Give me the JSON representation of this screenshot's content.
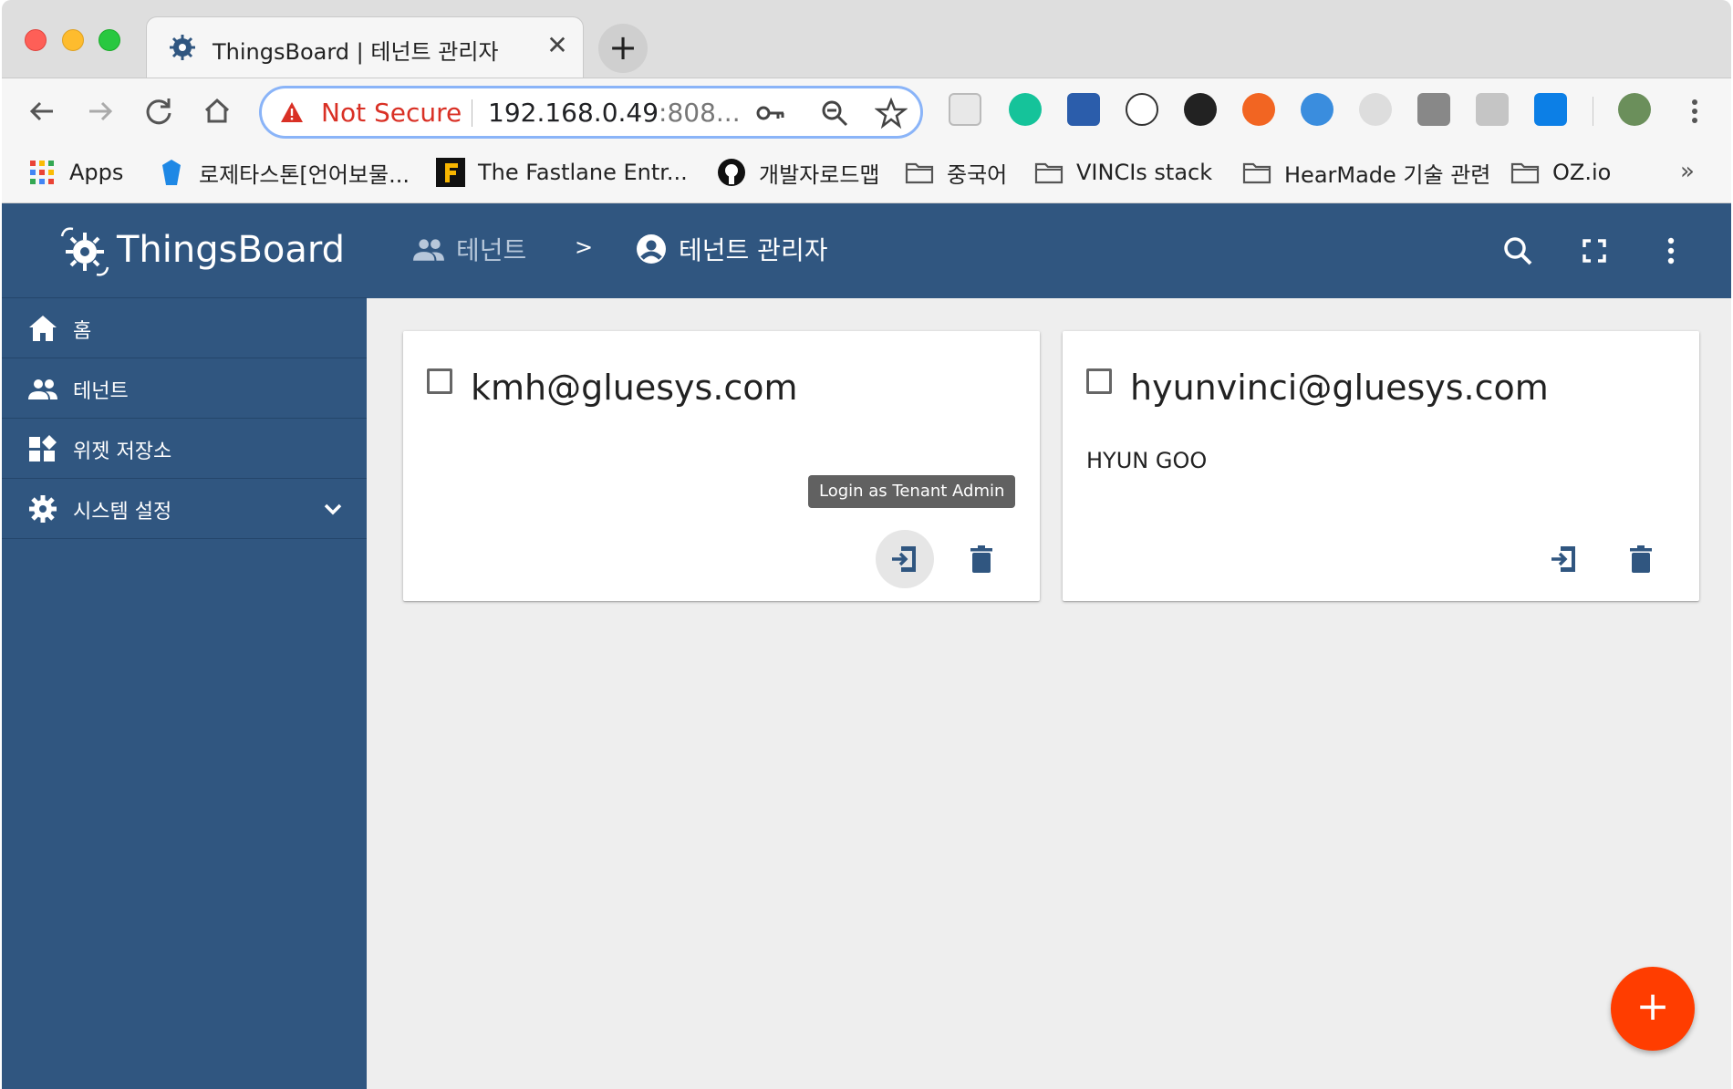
{
  "browser": {
    "tab_title": "ThingsBoard | 테넌트 관리자",
    "tab_close": "✕",
    "new_tab": "+",
    "security_label": "Not Secure",
    "url_host": "192.168.0.49",
    "url_rest": ":808...",
    "bookmarks": [
      {
        "label": "Apps",
        "icon": "apps-grid-icon"
      },
      {
        "label": "로제타스톤[언어보물...",
        "icon": "rosetta-stone-icon"
      },
      {
        "label": "The Fastlane Entr...",
        "icon": "fastlane-icon"
      },
      {
        "label": "개발자로드맵",
        "icon": "github-icon"
      },
      {
        "label": "중국어",
        "icon": "folder-icon"
      },
      {
        "label": "VINCIs stack",
        "icon": "folder-icon"
      },
      {
        "label": "HearMade 기술 관련",
        "icon": "folder-icon"
      },
      {
        "label": "OZ.io",
        "icon": "folder-icon"
      }
    ],
    "bookmarks_more": "»"
  },
  "app": {
    "brand": "ThingsBoard",
    "menu": [
      {
        "label": "홈",
        "icon": "home-icon"
      },
      {
        "label": "테넌트",
        "icon": "people-icon"
      },
      {
        "label": "위젯 저장소",
        "icon": "widgets-icon"
      },
      {
        "label": "시스템 설정",
        "icon": "gear-icon"
      }
    ],
    "breadcrumb": {
      "parent": "테넌트",
      "separator": ">",
      "current": "테넌트 관리자"
    },
    "cards": [
      {
        "title": "kmh@gluesys.com",
        "subtitle": "",
        "tooltip": "Login as Tenant Admin"
      },
      {
        "title": "hyunvinci@gluesys.com",
        "subtitle": "HYUN GOO"
      }
    ],
    "fab_label": "+"
  },
  "colors": {
    "primary": "#305680",
    "accent": "#ff3d00",
    "not_secure": "#d93025"
  }
}
